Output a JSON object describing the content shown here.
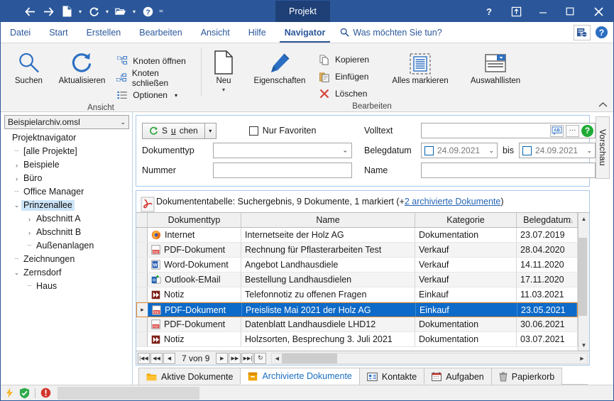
{
  "window": {
    "title_tab": "Projekt",
    "accent": "#2b579a",
    "quick_access": [
      {
        "name": "back",
        "glyph": "←"
      },
      {
        "name": "forward",
        "glyph": "→"
      },
      {
        "name": "new-document",
        "glyph": "page"
      },
      {
        "name": "refresh",
        "glyph": "refresh"
      },
      {
        "name": "open-folder",
        "glyph": "folder"
      },
      {
        "name": "help",
        "glyph": "?"
      },
      {
        "name": "customize-toolbar",
        "glyph": "▾"
      }
    ],
    "caption_buttons": [
      {
        "name": "help",
        "glyph": "?"
      },
      {
        "name": "ribbon-display-options",
        "glyph": "box"
      },
      {
        "name": "minimize",
        "glyph": "—"
      },
      {
        "name": "maximize",
        "glyph": "□"
      },
      {
        "name": "close",
        "glyph": "✕"
      }
    ]
  },
  "ribbon": {
    "tabs": [
      {
        "label": "Datei",
        "active": false
      },
      {
        "label": "Start",
        "active": false
      },
      {
        "label": "Erstellen",
        "active": false
      },
      {
        "label": "Bearbeiten",
        "active": false
      },
      {
        "label": "Ansicht",
        "active": false
      },
      {
        "label": "Hilfe",
        "active": false
      },
      {
        "label": "Navigator",
        "active": true
      }
    ],
    "tell_me": "Was möchten Sie tun?",
    "groups": [
      {
        "label": "Ansicht",
        "big_buttons": [
          {
            "label": "Suchen",
            "icon": "magnifier-icon"
          },
          {
            "label": "Aktualisieren",
            "icon": "refresh-icon"
          }
        ],
        "small_buttons": [
          {
            "label": "Knoten öffnen",
            "icon": "expand-node-icon"
          },
          {
            "label": "Knoten schließen",
            "icon": "collapse-node-icon"
          },
          {
            "label": "Optionen",
            "icon": "options-list-icon",
            "caret": "▾"
          }
        ]
      },
      {
        "label": "Bearbeiten",
        "big_buttons": [
          {
            "label": "Neu",
            "icon": "new-page-icon",
            "caret": "▾"
          },
          {
            "label": "Eigenschaften",
            "icon": "pencil-icon"
          }
        ],
        "small_buttons": [
          {
            "label": "Kopieren",
            "icon": "copy-icon"
          },
          {
            "label": "Einfügen",
            "icon": "paste-icon"
          },
          {
            "label": "Löschen",
            "icon": "delete-x-icon"
          }
        ],
        "extra_big": [
          {
            "label": "Alles markieren",
            "icon": "select-all-icon"
          },
          {
            "label": "Auswahllisten",
            "icon": "dropdown-list-icon"
          }
        ]
      }
    ]
  },
  "tree": {
    "archive_select": "Beispielarchiv.omsl",
    "root": "Projektnavigator",
    "items": [
      {
        "label": "[alle Projekte]",
        "level": 1,
        "expander": "",
        "selected": false
      },
      {
        "label": "Beispiele",
        "level": 1,
        "expander": "›",
        "selected": false
      },
      {
        "label": "Büro",
        "level": 1,
        "expander": "›",
        "selected": false
      },
      {
        "label": "Office Manager",
        "level": 1,
        "expander": "",
        "selected": false
      },
      {
        "label": "Prinzenallee",
        "level": 1,
        "expander": "⌄",
        "selected": true
      },
      {
        "label": "Abschnitt A",
        "level": 2,
        "expander": "›",
        "selected": false
      },
      {
        "label": "Abschnitt B",
        "level": 2,
        "expander": "›",
        "selected": false
      },
      {
        "label": "Außenanlagen",
        "level": 2,
        "expander": "",
        "selected": false
      },
      {
        "label": "Zeichnungen",
        "level": 1,
        "expander": "",
        "selected": false
      },
      {
        "label": "Zernsdorf",
        "level": 1,
        "expander": "⌄",
        "selected": false
      },
      {
        "label": "Haus",
        "level": 2,
        "expander": "",
        "selected": false
      }
    ]
  },
  "search": {
    "button_label_pre": "S",
    "button_label_u": "u",
    "button_label_post": "chen",
    "button_caret": "▾",
    "favorites_label": "Nur Favoriten",
    "favorites_checked": false,
    "fields": {
      "dokumenttyp_label": "Dokumenttyp",
      "dokumenttyp_value": "",
      "nummer_label": "Nummer",
      "nummer_value": "",
      "volltext_label": "Volltext",
      "volltext_value": "",
      "belegdatum_label": "Belegdatum",
      "belegdatum_from": "24.09.2021",
      "belegdatum_to": "24.09.2021",
      "bis_label": "bis",
      "name_label": "Name",
      "name_value": ""
    },
    "fulltext_icons": [
      {
        "name": "abc-icon",
        "label": "AB"
      },
      {
        "name": "ellipsis-icon",
        "label": "···"
      },
      {
        "name": "help-icon",
        "label": "?"
      }
    ]
  },
  "preview_tab": "Vorschau",
  "table": {
    "info_prefix": "Dokumententabelle: Suchergebnis, 9 Dokumente, 1 markiert (+",
    "info_link": "2 archivierte Dokumente",
    "info_suffix": ")",
    "columns": [
      "Dokumenttyp",
      "Name",
      "Kategorie",
      "Belegdatum"
    ],
    "sort_column": "Belegdatum",
    "sort_mark": "△",
    "rows": [
      {
        "icon": "firefox-icon",
        "doctype": "Internet",
        "name": "Internetseite der Holz AG",
        "kategorie": "Dokumentation",
        "belegdatum": "23.07.2019",
        "selected": false
      },
      {
        "icon": "pdf-icon",
        "doctype": "PDF-Dokument",
        "name": "Rechnung für Pflasterarbeiten Test",
        "kategorie": "Verkauf",
        "belegdatum": "28.04.2020",
        "selected": false
      },
      {
        "icon": "word-icon",
        "doctype": "Word-Dokument",
        "name": "Angebot Landhausdiele",
        "kategorie": "Verkauf",
        "belegdatum": "14.11.2020",
        "selected": false
      },
      {
        "icon": "outlook-icon",
        "doctype": "Outlook-EMail",
        "name": "Bestellung Landhausdielen",
        "kategorie": "Verkauf",
        "belegdatum": "17.11.2020",
        "selected": false
      },
      {
        "icon": "note-icon",
        "doctype": "Notiz",
        "name": "Telefonnotiz zu offenen Fragen",
        "kategorie": "Einkauf",
        "belegdatum": "11.03.2021",
        "selected": false
      },
      {
        "icon": "pdf-icon",
        "doctype": "PDF-Dokument",
        "name": "Preisliste Mai 2021 der Holz AG",
        "kategorie": "Einkauf",
        "belegdatum": "23.05.2021",
        "selected": true
      },
      {
        "icon": "pdf-icon",
        "doctype": "PDF-Dokument",
        "name": "Datenblatt Landhausdiele LHD12",
        "kategorie": "Dokumentation",
        "belegdatum": "30.06.2021",
        "selected": false
      },
      {
        "icon": "note-icon",
        "doctype": "Notiz",
        "name": "Holzsorten, Besprechung 3. Juli 2021",
        "kategorie": "Dokumentation",
        "belegdatum": "03.07.2021",
        "selected": false
      }
    ],
    "nav": {
      "first": "|◀◀",
      "prev_page": "◀◀",
      "prev": "◀",
      "position": "7 von 9",
      "next": "▶",
      "next_page": "▶▶",
      "last": "▶▶|",
      "refresh": "↻"
    }
  },
  "bottom_tabs": [
    {
      "label": "Aktive Dokumente",
      "icon": "folder-icon",
      "active": false
    },
    {
      "label": "Archivierte Dokumente",
      "icon": "archive-box-icon",
      "active": true
    },
    {
      "label": "Kontakte",
      "icon": "contact-card-icon",
      "active": false
    },
    {
      "label": "Aufgaben",
      "icon": "calendar-icon",
      "active": false
    },
    {
      "label": "Papierkorb",
      "icon": "trash-icon",
      "active": false
    }
  ],
  "statusbar": {
    "icons": [
      {
        "name": "lightning-icon",
        "color": "#f5b423"
      },
      {
        "name": "shield-ok-icon",
        "color": "#2eaa4a"
      },
      {
        "name": "error-icon",
        "color": "#d4342b"
      }
    ]
  }
}
